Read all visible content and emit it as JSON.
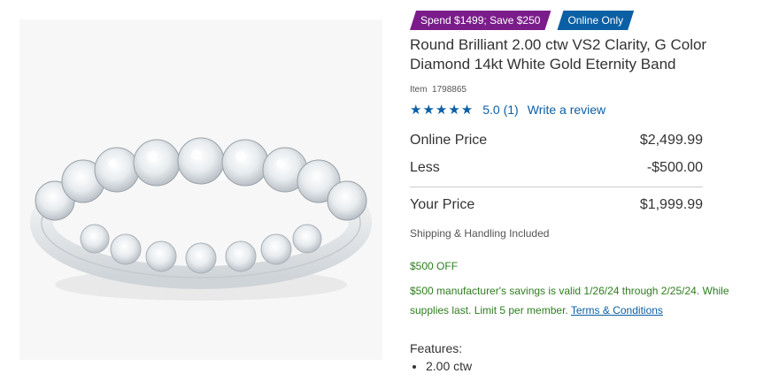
{
  "product": {
    "badges": {
      "promo": "Spend $1499; Save $250",
      "online": "Online Only"
    },
    "title": "Round Brilliant 2.00 ctw VS2 Clarity, G Color Diamond 14kt White Gold Eternity Band",
    "item_label": "Item",
    "item_number": "1798865",
    "rating": {
      "stars": "★★★★★",
      "score": "5.0",
      "count": "(1)",
      "write_review": "Write a review"
    },
    "prices": {
      "online_label": "Online Price",
      "online_value": "$2,499.99",
      "less_label": "Less",
      "less_value": "-$500.00",
      "your_label": "Your Price",
      "your_value": "$1,999.99"
    },
    "shipping": "Shipping & Handling Included",
    "offer": {
      "headline": "$500 OFF",
      "details": "$500 manufacturer's savings is valid 1/26/24 through 2/25/24. While supplies last. Limit 5 per member.",
      "terms_link": "Terms & Conditions"
    },
    "features": {
      "heading": "Features:",
      "items": [
        "2.00 ctw"
      ]
    }
  },
  "colors": {
    "promo_badge": "#7a1d8a",
    "online_badge": "#0b5fa5",
    "link": "#0b5fa5",
    "savings_text": "#2e7d1e"
  }
}
